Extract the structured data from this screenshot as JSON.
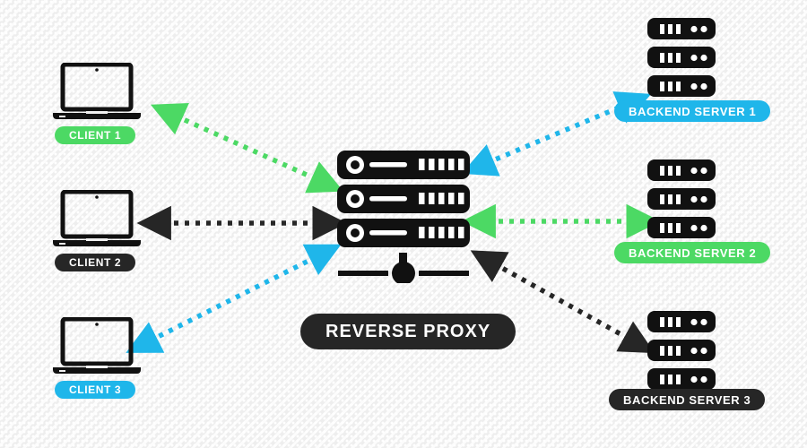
{
  "diagram": {
    "title": "Reverse Proxy network topology diagram",
    "background_color": "#eeeeee",
    "colors": {
      "green": "#4cd964",
      "green_alt": "#3ddb5e",
      "blue": "#1fb6ea",
      "dark": "#262626",
      "white": "#ffffff"
    }
  },
  "center": {
    "label": "REVERSE PROXY",
    "label_color": "#262626",
    "icon": "rack-server-icon"
  },
  "clients": [
    {
      "id": "client-1",
      "label": "CLIENT 1",
      "color": "#4cd964",
      "icon": "laptop-icon",
      "link_color": "#4cd964",
      "link_style": "dotted-double-arrow"
    },
    {
      "id": "client-2",
      "label": "CLIENT 2",
      "color": "#262626",
      "icon": "laptop-icon",
      "link_color": "#262626",
      "link_style": "dotted-double-arrow"
    },
    {
      "id": "client-3",
      "label": "CLIENT 3",
      "color": "#1fb6ea",
      "icon": "laptop-icon",
      "link_color": "#1fb6ea",
      "link_style": "dotted-double-arrow"
    }
  ],
  "backends": [
    {
      "id": "backend-1",
      "label": "BACKEND SERVER 1",
      "color": "#1fb6ea",
      "icon": "server-stack-icon",
      "link_color": "#1fb6ea",
      "link_style": "dotted-double-arrow"
    },
    {
      "id": "backend-2",
      "label": "BACKEND SERVER 2",
      "color": "#4cd964",
      "icon": "server-stack-icon",
      "link_color": "#4cd964",
      "link_style": "dotted-double-arrow"
    },
    {
      "id": "backend-3",
      "label": "BACKEND SERVER 3",
      "color": "#262626",
      "icon": "server-stack-icon",
      "link_color": "#262626",
      "link_style": "dotted-double-arrow"
    }
  ]
}
